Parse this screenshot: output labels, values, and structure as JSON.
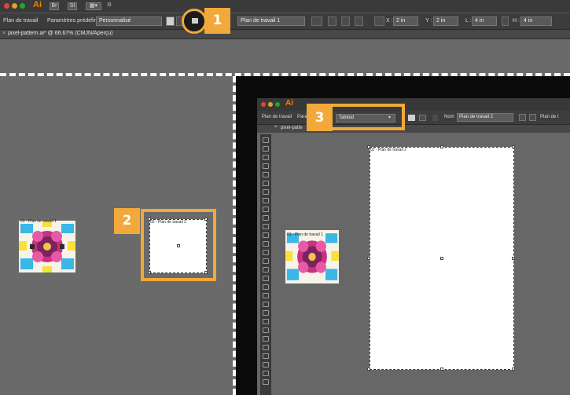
{
  "app": {
    "logo": "Ai",
    "buttons": [
      "Br",
      "St"
    ]
  },
  "control_bar": {
    "artboard_label": "Plan de travail",
    "preset_label": "Paramètres prédéfinis :",
    "preset_value": "Personnalisé",
    "name_value": "Plan de travail 1",
    "x_label": "X :",
    "x_value": "2 in",
    "y_label": "Y :",
    "y_value": "2 in",
    "l_label": "L :",
    "l_value": "4 in",
    "h_label": "H :",
    "h_value": "4 in"
  },
  "document_tab": {
    "close": "×",
    "title": "pixel-pattern.ai* @ 66.67% (CMJN/Aperçu)"
  },
  "steps": [
    "1",
    "2",
    "3"
  ],
  "left_view": {
    "artwork_label": "01 - Plan de travail 1",
    "new_artboard_label": "02 - Plan de travail 2"
  },
  "inset": {
    "logo": "Ai",
    "artboard_label": "Plan de travail",
    "preset_label": "Para",
    "preset_value": "Tabloid",
    "name_label": "Nom",
    "name_value": "Plan de travail 2",
    "right_label": "Plan de t",
    "doc_title": "pixel-patte",
    "artwork_label": "01 - Plan de travail 1",
    "artboard2_label": "02 - Plan de travail 2"
  },
  "colors": {
    "accent": "#f0a93a",
    "chrome_dark": "#3c3c3c",
    "canvas": "#6a6a6a"
  }
}
